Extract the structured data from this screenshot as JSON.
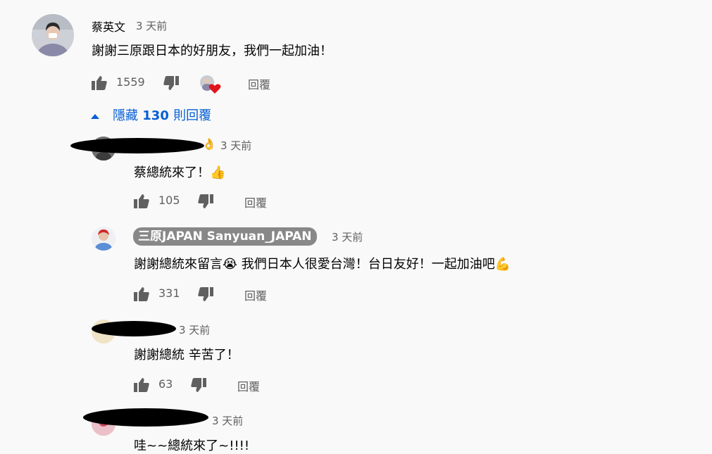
{
  "colors": {
    "link_blue": "#065fd4",
    "muted": "#606060",
    "text": "#030303",
    "heart": "#e0141e",
    "badge_bg": "#888888"
  },
  "top_comment": {
    "author": "蔡英文",
    "time": "3 天前",
    "text": "謝謝三原跟日本的好朋友，我們一起加油！",
    "likes": "1559",
    "reply_label": "回覆",
    "icons": [
      "thumb-up-icon",
      "thumb-down-icon",
      "creator-heart-icon"
    ]
  },
  "replies_toggle": {
    "prefix": "隱藏",
    "count": "130",
    "suffix": "則回覆",
    "icon": "chevron-up-icon"
  },
  "replies": [
    {
      "author": "",
      "emoji": "👌",
      "time": "3 天前",
      "text": "蔡總統來了！",
      "text_emoji": "👍",
      "likes": "105",
      "reply_label": "回覆"
    },
    {
      "author": "三原JAPAN Sanyuan_JAPAN",
      "time": "3 天前",
      "text": "謝謝總統來留言",
      "text_emoji": "😭",
      "text_after": " 我們日本人很愛台灣！台日友好！一起加油吧",
      "text_emoji2": "💪",
      "likes": "331",
      "reply_label": "回覆"
    },
    {
      "author": "",
      "time": "3 天前",
      "text": "謝謝總統 辛苦了！",
      "likes": "63",
      "reply_label": "回覆"
    },
    {
      "author": "",
      "time": "3 天前",
      "text": "哇~~總統來了~!!!!"
    }
  ]
}
